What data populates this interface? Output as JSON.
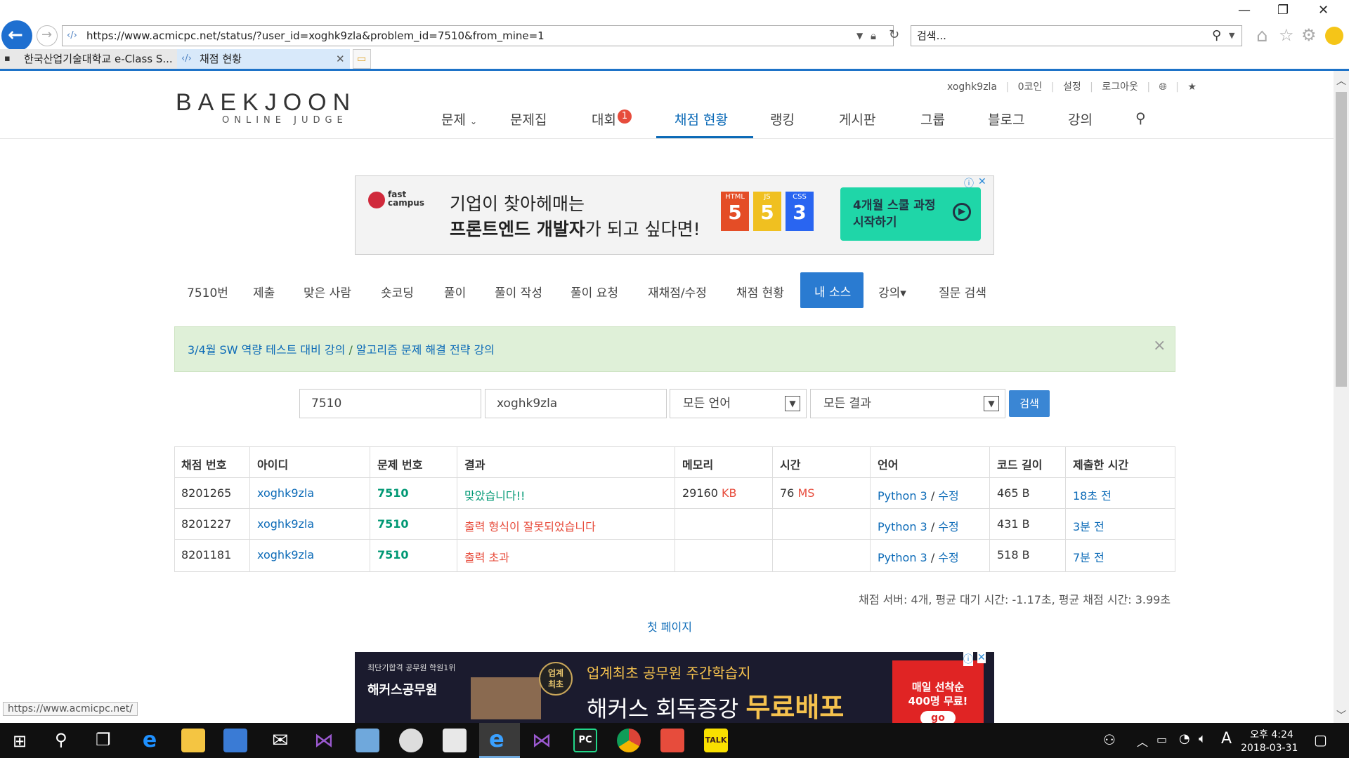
{
  "browser": {
    "url": "https://www.acmicpc.net/status/?user_id=xoghk9zla&problem_id=7510&from_mine=1",
    "search_placeholder": "검색...",
    "tabs": [
      {
        "label": "한국산업기술대학교 e-Class S..."
      },
      {
        "label": "채점 현황"
      }
    ],
    "status_url": "https://www.acmicpc.net/"
  },
  "site": {
    "logo_main": "BAEKJOON",
    "logo_sub": "ONLINE JUDGE",
    "user_links": [
      "xoghk9zla",
      "0코인",
      "설정",
      "로그아웃"
    ],
    "nav": [
      "문제",
      "문제집",
      "대회",
      "채점 현황",
      "랭킹",
      "게시판",
      "그룹",
      "블로그",
      "강의"
    ],
    "contest_badge": "1",
    "active_nav": "채점 현황"
  },
  "ad_top": {
    "brand": "fast campus",
    "line1": "기업이 찾아헤매는",
    "line2_bold": "프론트엔드 개발자",
    "line2_rest": "가 되고 싶다면!",
    "badges": [
      "HTML",
      "JS",
      "CSS"
    ],
    "cta": "4개월 스쿨 과정\n시작하기"
  },
  "subnav": [
    "7510번",
    "제출",
    "맞은 사람",
    "숏코딩",
    "풀이",
    "풀이 작성",
    "풀이 요청",
    "재채점/수정",
    "채점 현황",
    "내 소스",
    "강의▾",
    "질문 검색"
  ],
  "subnav_active": "내 소스",
  "notice": {
    "link1": "3/4월 SW 역량 테스트 대비 강의",
    "sep": " / ",
    "link2": "알고리즘 문제 해결 전략 강의",
    "close": "×"
  },
  "filters": {
    "problem_id": "7510",
    "user_id": "xoghk9zla",
    "language": "모든 언어",
    "result": "모든 결과",
    "search_button": "검색"
  },
  "table": {
    "headers": [
      "채점 번호",
      "아이디",
      "문제 번호",
      "결과",
      "메모리",
      "시간",
      "언어",
      "코드 길이",
      "제출한 시간"
    ],
    "rows": [
      {
        "id": "8201265",
        "user": "xoghk9zla",
        "problem": "7510",
        "result": "맞았습니다!!",
        "result_type": "ac",
        "memory": "29160",
        "memory_unit": "KB",
        "time": "76",
        "time_unit": "MS",
        "lang": "Python 3",
        "edit": "수정",
        "length": "465 B",
        "submitted": "18초 전"
      },
      {
        "id": "8201227",
        "user": "xoghk9zla",
        "problem": "7510",
        "result": "출력 형식이 잘못되었습니다",
        "result_type": "pe",
        "memory": "",
        "memory_unit": "",
        "time": "",
        "time_unit": "",
        "lang": "Python 3",
        "edit": "수정",
        "length": "431 B",
        "submitted": "3분 전"
      },
      {
        "id": "8201181",
        "user": "xoghk9zla",
        "problem": "7510",
        "result": "출력 초과",
        "result_type": "ole",
        "memory": "",
        "memory_unit": "",
        "time": "",
        "time_unit": "",
        "lang": "Python 3",
        "edit": "수정",
        "length": "518 B",
        "submitted": "7분 전"
      }
    ]
  },
  "server_status": "채점 서버: 4개, 평균 대기 시간: -1.17초, 평균 채점 시간: 3.99초",
  "first_page": "첫 페이지",
  "ad_bottom": {
    "left_top": "최단기합격 공무원 학원1위",
    "left_brand": "해커스공무원",
    "circle": "업계\n최초",
    "line1": "업계최초 공무원 주간학습지",
    "line2": "해커스 회독증강",
    "line2_big": "무료배포",
    "right": "매일 선착순\n400명 무료!",
    "go": "go"
  },
  "taskbar": {
    "time": "오후 4:24",
    "date": "2018-03-31",
    "ime": "A"
  }
}
